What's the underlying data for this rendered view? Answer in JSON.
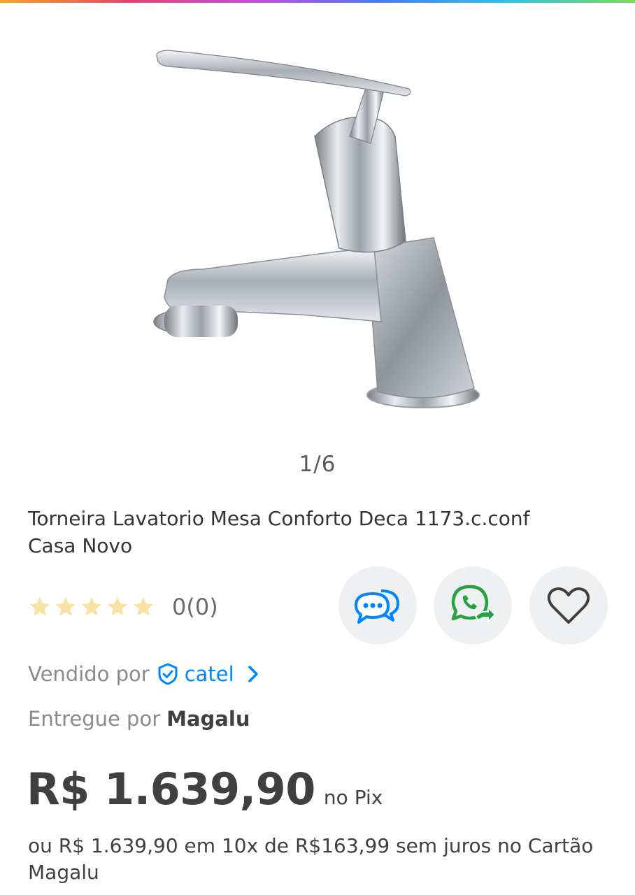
{
  "image_gallery": {
    "counter": "1/6"
  },
  "product": {
    "title": "Torneira Lavatorio Mesa Conforto Deca 1173.c.conf Casa Novo"
  },
  "rating": {
    "stars": 0,
    "max_stars": 5,
    "count_text": "0(0)"
  },
  "actions": [
    {
      "name": "chat",
      "icon": "chat-bubbles-icon",
      "color": "#0086ff"
    },
    {
      "name": "share-whatsapp",
      "icon": "whatsapp-share-icon",
      "color": "#25a244"
    },
    {
      "name": "favorite",
      "icon": "heart-outline-icon",
      "color": "#404040"
    }
  ],
  "seller": {
    "label": "Vendido por",
    "name": "catel",
    "verified_icon": "verified-shield-icon"
  },
  "delivery": {
    "label": "Entregue por",
    "carrier": "Magalu"
  },
  "pricing": {
    "price": "R$ 1.639,90",
    "price_suffix": "no Pix",
    "installments": "ou R$ 1.639,90 em 10x de R$163,99 sem juros no Cartão Magalu"
  },
  "colors": {
    "accent_blue": "#0086ff",
    "star_empty": "#f7e3a6",
    "text_dark": "#404040",
    "text_muted": "#8a8a8a",
    "button_bg": "#eef0f1"
  }
}
